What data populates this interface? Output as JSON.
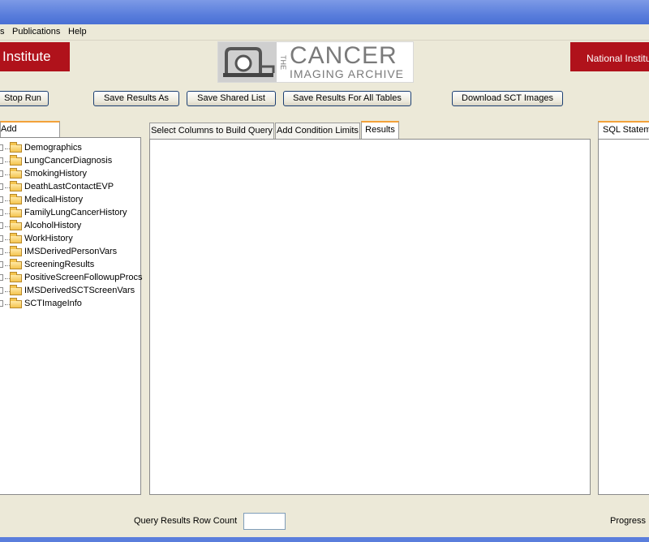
{
  "menu": {
    "items": [
      {
        "label": "s"
      },
      {
        "label": "Publications"
      },
      {
        "label": "Help"
      }
    ]
  },
  "banner": {
    "left_text": "Institute",
    "right_text": "National Institu",
    "logo": {
      "the": "THE",
      "cancer": "CANCER",
      "imaging_archive": "IMAGING ARCHIVE"
    }
  },
  "toolbar": {
    "stop_run": "Stop Run",
    "save_results_as": "Save Results As",
    "save_shared_list": "Save Shared List",
    "save_results_all_tables": "Save Results For All Tables",
    "download_sct_images": "Download SCT Images"
  },
  "left_panel": {
    "tab_label": "Add Conditions",
    "tree_items": [
      "Demographics",
      "LungCancerDiagnosis",
      "SmokingHistory",
      "DeathLastContactEVP",
      "MedicalHistory",
      "FamilyLungCancerHistory",
      "AlcoholHistory",
      "WorkHistory",
      "IMSDerivedPersonVars",
      "ScreeningResults",
      "PositiveScreenFollowupProcs",
      "IMSDerivedSCTScreenVars",
      "SCTImageInfo"
    ]
  },
  "center_panel": {
    "tabs": [
      {
        "label": "Select Columns to Build Query",
        "active": false
      },
      {
        "label": "Add Condition Limits",
        "active": false
      },
      {
        "label": "Results",
        "active": true
      }
    ]
  },
  "right_panel": {
    "tab_label": "SQL Statem"
  },
  "status": {
    "row_count_label": "Query Results Row Count",
    "row_count_value": "",
    "progress_label": "Progress M"
  },
  "colors": {
    "accent_red": "#b0121b",
    "tab_highlight": "#f3a13a",
    "title_blue": "#5a7edc"
  }
}
